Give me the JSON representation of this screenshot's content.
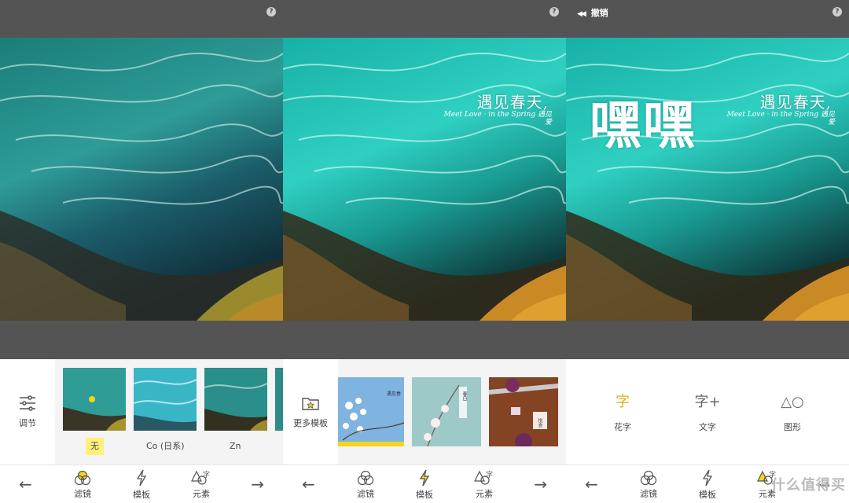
{
  "screens": [
    {
      "help": "?",
      "tray": {
        "adjust_label": "调节",
        "filters": [
          {
            "label": "无",
            "selected": true
          },
          {
            "label": "Co (日系)",
            "selected": false
          },
          {
            "label": "Zn",
            "selected": false
          }
        ]
      },
      "nav": {
        "filters": "滤镜",
        "templates": "模板",
        "elements": "元素",
        "active": "filters"
      }
    },
    {
      "help": "?",
      "overlay": {
        "title": "遇见春天,",
        "sub_en": "Meet Love · in the Spring",
        "sub_cn": "遇见爱"
      },
      "tray": {
        "more_templates_label": "更多模板",
        "templates": [
          {
            "caption": "遇见春"
          },
          {
            "caption": "春日"
          },
          {
            "caption": "悦食"
          }
        ]
      },
      "nav": {
        "filters": "滤镜",
        "templates": "模板",
        "elements": "元素",
        "active": "templates"
      }
    },
    {
      "help": "?",
      "undo_label": "撤销",
      "overlay": {
        "title": "遇见春天,",
        "sub_en": "Meet Love · in the Spring",
        "sub_cn": "遇见爱",
        "big": "嘿嘿"
      },
      "tray": {
        "tools": [
          {
            "glyph": "字",
            "label": "花字"
          },
          {
            "glyph": "字+",
            "label": "文字"
          },
          {
            "glyph": "△○",
            "label": "图形"
          }
        ]
      },
      "nav": {
        "filters": "滤镜",
        "templates": "模板",
        "elements": "元素",
        "active": "elements"
      },
      "watermark": "什么值得买"
    }
  ],
  "colors": {
    "topbar": "#545454",
    "accent_yellow": "#f5d51e",
    "selected_bg": "#fff07a"
  }
}
